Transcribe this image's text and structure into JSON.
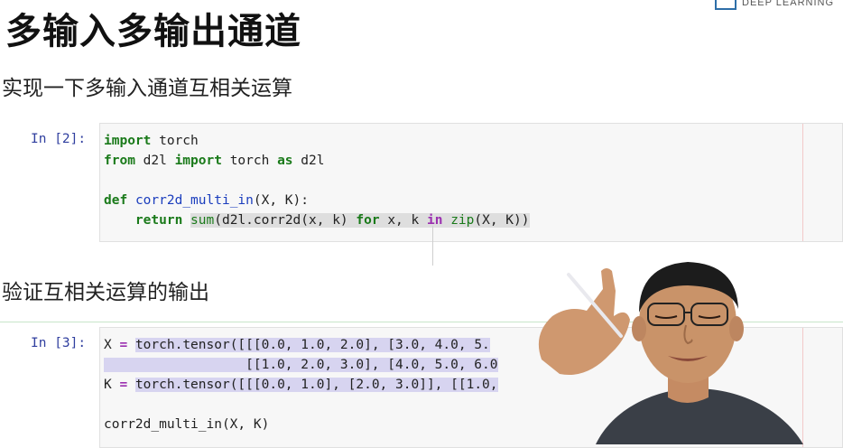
{
  "title": "多输入多输出通道",
  "brand": {
    "text": "DEEP LEARNING"
  },
  "section1": {
    "heading": "实现一下多输入通道互相关运算"
  },
  "cell1": {
    "prompt": "In [2]:",
    "lines": [
      "import torch",
      "from d2l import torch as d2l",
      "",
      "def corr2d_multi_in(X, K):",
      "    return sum(d2l.corr2d(x, k) for x, k in zip(X, K))"
    ]
  },
  "section2": {
    "heading": "验证互相关运算的输出"
  },
  "cell2": {
    "prompt": "In [3]:",
    "lines": [
      "X = torch.tensor([[[0.0, 1.0, 2.0], [3.0, 4.0, 5.",
      "                  [[1.0, 2.0, 3.0], [4.0, 5.0, 6.0",
      "K = torch.tensor([[[0.0, 1.0], [2.0, 3.0]], [[1.0,",
      "",
      "corr2d_multi_in(X, K)"
    ]
  },
  "colors": {
    "keyword": "#1a7a1a",
    "operator": "#9b30b0",
    "prompt": "#303f9f",
    "selection": "#d7d4f0"
  }
}
